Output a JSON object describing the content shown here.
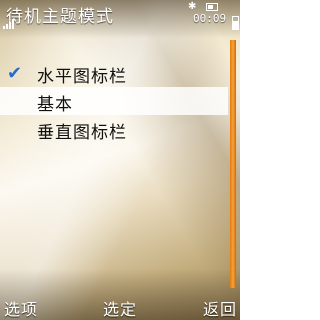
{
  "header": {
    "title": "待机主题模式",
    "clock": "00:09"
  },
  "menu": {
    "items": [
      {
        "label": "水平图标栏",
        "checked": true
      },
      {
        "label": "基本",
        "highlighted": true
      },
      {
        "label": "垂直图标栏"
      }
    ]
  },
  "softkeys": {
    "left": "选项",
    "middle": "选定",
    "right": "返回"
  },
  "icons": {
    "check": "checkmark-icon",
    "bluetooth": "bluetooth-icon",
    "battery": "battery-icon",
    "signal": "signal-strength-icon"
  },
  "colors": {
    "accent_scroll": "#f08c1e",
    "check": "#2a6dc8",
    "highlight": "#ffffff"
  }
}
